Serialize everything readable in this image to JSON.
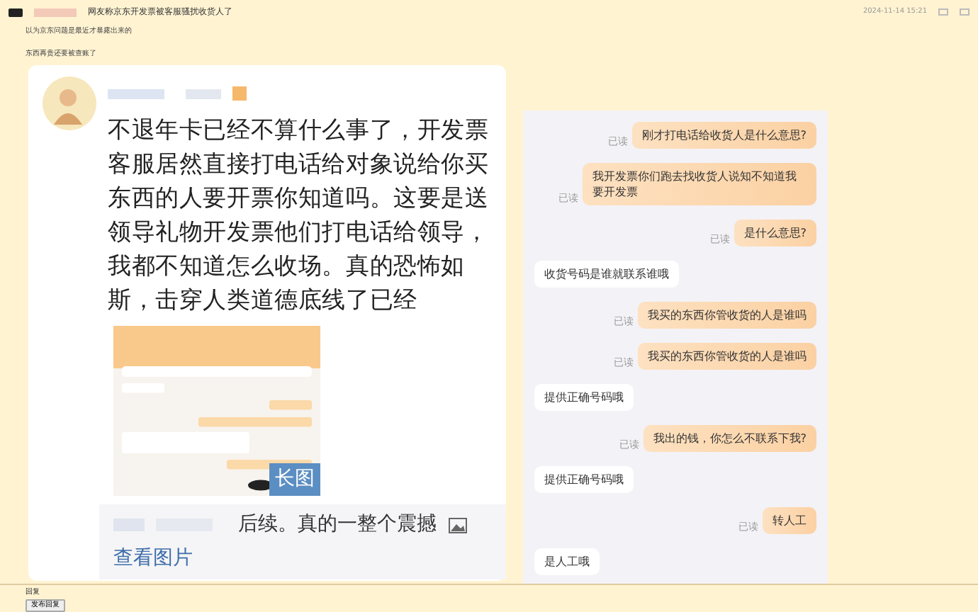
{
  "post": {
    "title": "网友称京东开发票被客服骚扰收货人了",
    "date": "2024-11-14 15:21",
    "lines": [
      "以为京东问题是最近才暴露出来的",
      "东西再贵还要被查账了"
    ]
  },
  "comment": {
    "text": "不退年卡已经不算什么事了，开发票客服居然直接打电话给对象说给你买东西的人要开票你知道吗。这要是送领导礼物开发票他们打电话给领导，我都不知道怎么收场。真的恐怖如斯，击穿人类道德底线了已经",
    "image_badge": "长图",
    "followup": "后续。真的一整个震撼",
    "view_link": "查看图片"
  },
  "chat": [
    {
      "kind": "out",
      "text": "刚才打电话给收货人是什么意思?",
      "status": "已读"
    },
    {
      "kind": "out",
      "text": "我开发票你们跑去找收货人说知不知道我要开发票",
      "status": "已读"
    },
    {
      "kind": "out",
      "text": "是什么意思?",
      "status": "已读"
    },
    {
      "kind": "in",
      "text": "收货号码是谁就联系谁哦"
    },
    {
      "kind": "out",
      "text": "我买的东西你管收货的人是谁吗",
      "status": "已读"
    },
    {
      "kind": "out",
      "text": "我买的东西你管收货的人是谁吗",
      "status": "已读"
    },
    {
      "kind": "in",
      "text": "提供正确号码哦"
    },
    {
      "kind": "out",
      "text": "我出的钱，你怎么不联系下我?",
      "status": "已读"
    },
    {
      "kind": "in",
      "text": "提供正确号码哦"
    },
    {
      "kind": "out",
      "text": "转人工",
      "status": "已读"
    },
    {
      "kind": "in",
      "text": "是人工哦"
    }
  ],
  "footer": {
    "label": "回复",
    "button": "发布回复"
  }
}
